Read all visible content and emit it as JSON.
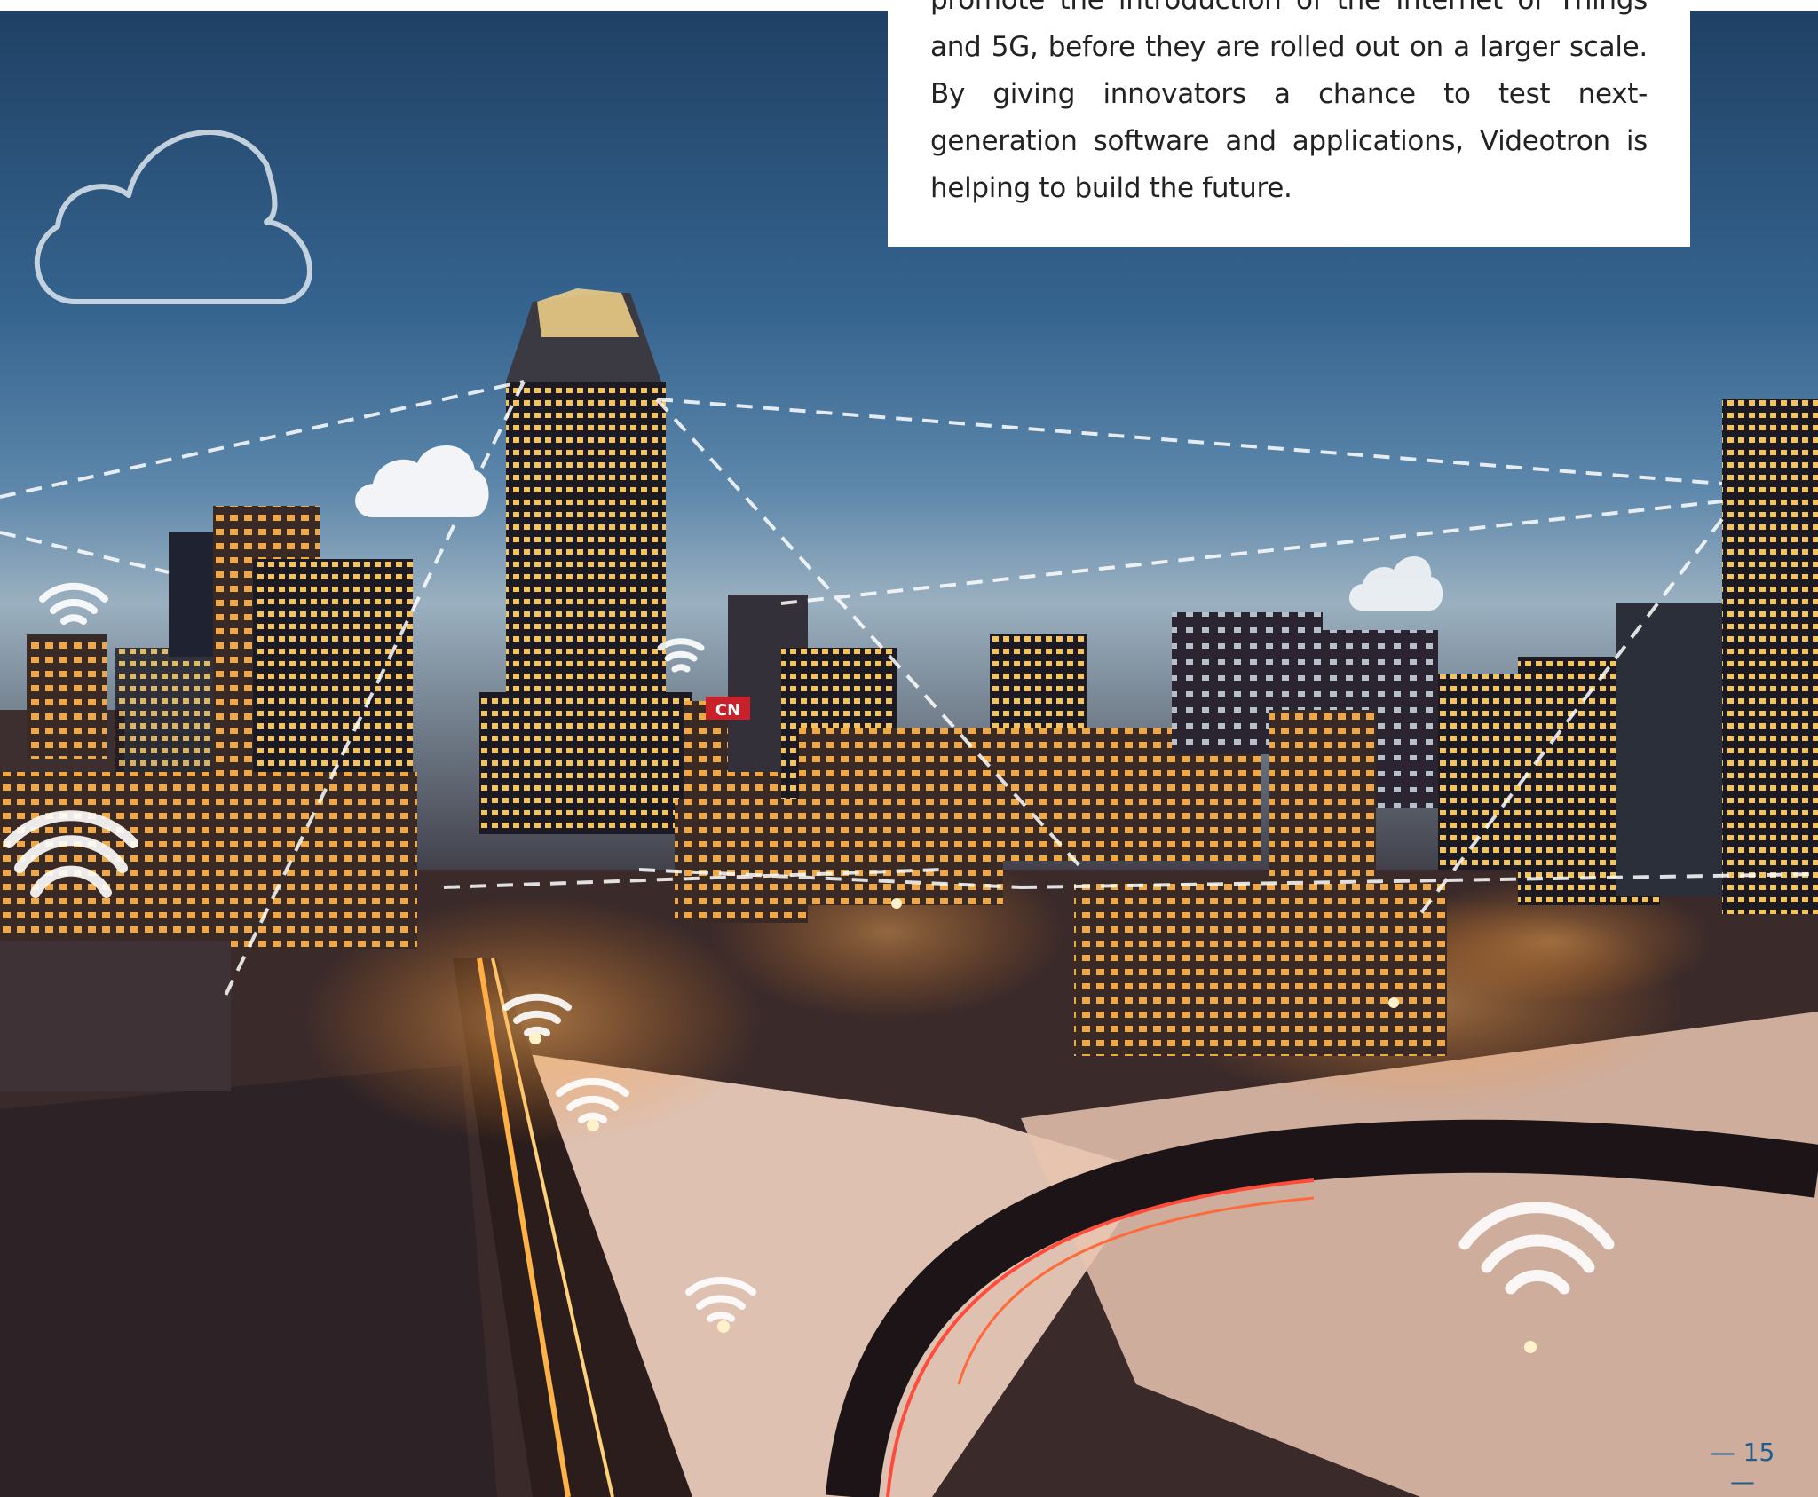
{
  "text_block": {
    "paragraph": "promote the introduction of the Internet of Things and 5G, before they are rolled out on a larger scale. By giving innovators a chance to test next-generation software and applications, Videotron is helping to build the future."
  },
  "page_number": "— 15 —",
  "photo": {
    "sign_text": "CN"
  },
  "colors": {
    "sky_top": "#2d5a86",
    "sky_mid": "#4a79a3",
    "sky_low": "#9bb3c4",
    "snow": "#f4d7c4",
    "street_glow": "#ff8a1e",
    "page_number": "#1f5d8e"
  },
  "icons": [
    "cloud-outline-icon",
    "cloud-icon",
    "wifi-icon"
  ]
}
